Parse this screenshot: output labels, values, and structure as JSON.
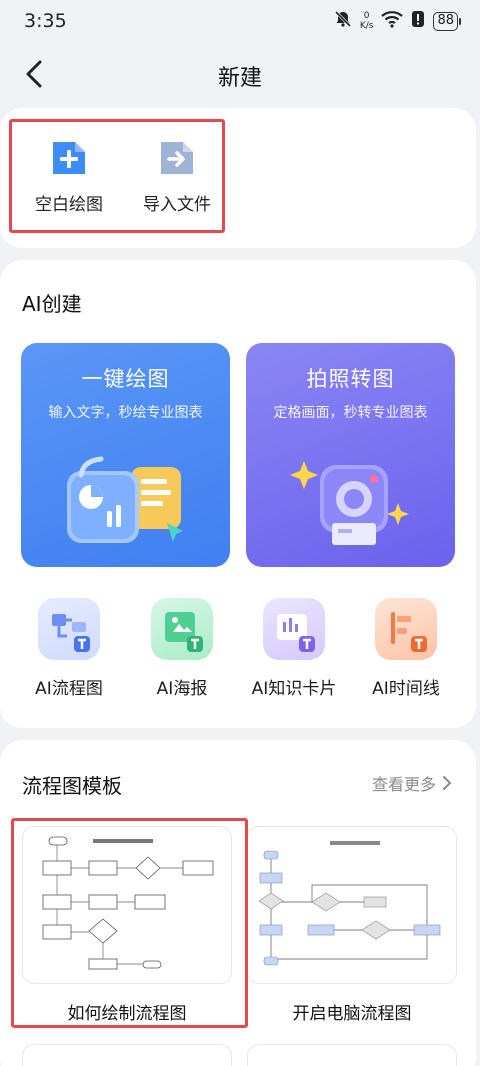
{
  "status": {
    "time": "3:35",
    "net_speed_value": "0",
    "net_speed_unit": "K/s",
    "battery": "88"
  },
  "nav": {
    "title": "新建"
  },
  "quick_actions": [
    {
      "label": "空白绘图",
      "icon": "plus-document-icon"
    },
    {
      "label": "导入文件",
      "icon": "import-document-icon"
    }
  ],
  "ai_section": {
    "title": "AI创建",
    "promos": [
      {
        "title": "一键绘图",
        "desc": "输入文字，秒绘专业图表",
        "icon": "chart-illustration-icon"
      },
      {
        "title": "拍照转图",
        "desc": "定格画面，秒转专业图表",
        "icon": "camera-illustration-icon"
      }
    ],
    "tools": [
      {
        "label": "AI流程图",
        "icon": "flowchart-icon",
        "color": "#6f8ef5"
      },
      {
        "label": "AI海报",
        "icon": "poster-icon",
        "color": "#3fc98a"
      },
      {
        "label": "AI知识卡片",
        "icon": "knowledge-card-icon",
        "color": "#8f7cf2"
      },
      {
        "label": "AI时间线",
        "icon": "timeline-icon",
        "color": "#f47a4a"
      }
    ]
  },
  "template_section": {
    "title": "流程图模板",
    "more": "查看更多",
    "templates": [
      {
        "label": "如何绘制流程图"
      },
      {
        "label": "开启电脑流程图"
      }
    ]
  },
  "colors": {
    "accent_red": "#e5484d",
    "promo_blue": "#4a88f3",
    "promo_purple": "#7a73f0"
  }
}
